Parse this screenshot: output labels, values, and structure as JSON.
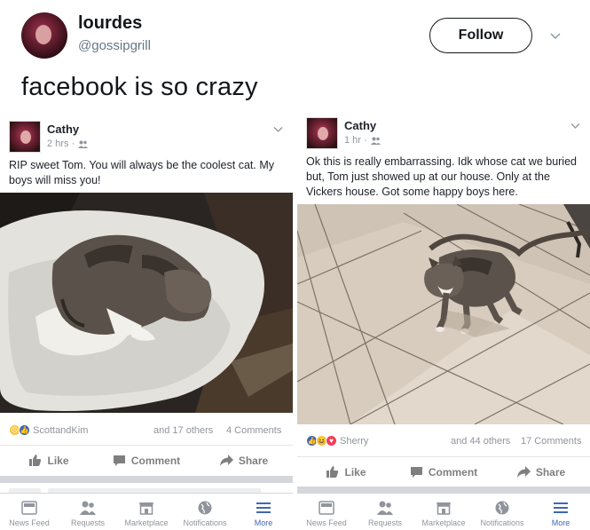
{
  "tweet": {
    "user_name": "lourdes",
    "user_handle": "@gossipgrill",
    "follow_label": "Follow",
    "text": "facebook is so crazy"
  },
  "left_post": {
    "author": "Cathy",
    "time": "2 hrs ·",
    "text": "RIP sweet Tom.  You will always be the coolest cat. My boys will miss you!",
    "reactors": "ScottandKim",
    "others": "and 17 others",
    "comments": "4 Comments",
    "actions": {
      "like": "Like",
      "comment": "Comment",
      "share": "Share"
    }
  },
  "right_post": {
    "author": "Cathy",
    "time": "1 hr ·",
    "text": "Ok this is really embarrassing.  Idk whose cat we buried but, Tom just showed up at our house. Only at the Vickers house.  Got some happy boys here.",
    "reactors": "Sherry",
    "others": "and 44 others",
    "comments": "17 Comments",
    "actions": {
      "like": "Like",
      "comment": "Comment",
      "share": "Share"
    }
  },
  "tabbar": {
    "news_feed": "News Feed",
    "requests": "Requests",
    "marketplace": "Marketplace",
    "notifications": "Notifications",
    "more": "More"
  },
  "colors": {
    "facebook_blue": "#4267b2",
    "text_gray": "#90949c",
    "divider_gray": "#d3d6db"
  }
}
